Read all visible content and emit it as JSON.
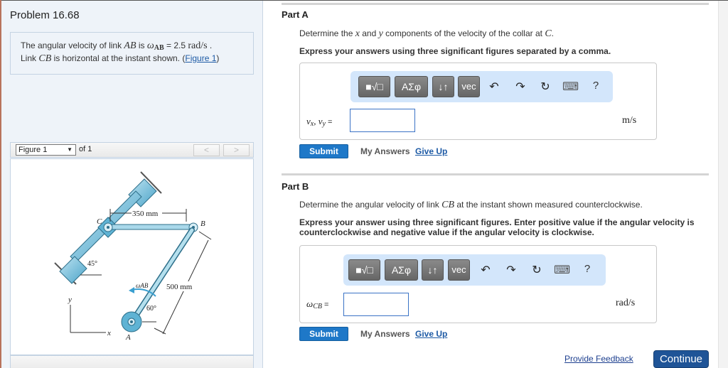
{
  "problem": {
    "title": "Problem 16.68",
    "statement": {
      "prefix": "The angular velocity of link ",
      "link_ab": "AB",
      "is": " is ",
      "omega": "ω",
      "omega_sub": "AB",
      "equals": " = 2.5 ",
      "unit": "rad/s",
      "period": " .",
      "line2_prefix": "Link ",
      "link_cb": "CB",
      "line2_suffix": " is horizontal at the instant shown. (",
      "figure_link": "Figure 1",
      "close_paren": ")"
    }
  },
  "figure_viewer": {
    "selected": "Figure 1",
    "of_label": "of 1",
    "prev": "<",
    "next": ">",
    "labels": {
      "dim_cb": "350 mm",
      "dim_ab": "500 mm",
      "c": "C",
      "b": "B",
      "a": "A",
      "angle_collar": "45°",
      "angle_ab": "60°",
      "omega_ab": "ωAB",
      "axis_x": "x",
      "axis_y": "y"
    }
  },
  "part_a": {
    "title": "Part A",
    "question_prefix": "Determine the ",
    "var_x": "x",
    "and": " and ",
    "var_y": "y",
    "question_mid": " components of the velocity of the collar at ",
    "point": "C",
    "question_end": ".",
    "instruction": "Express your answers using three significant figures separated by a comma.",
    "answer_label": "vx, vy",
    "answer_label_parts": {
      "v1": "v",
      "s1": "x",
      "sep": ", ",
      "v2": "v",
      "s2": "y",
      "eq": " ="
    },
    "answer_value": "",
    "unit": "m/s",
    "submit": "Submit",
    "my_answers": "My Answers",
    "give_up": "Give Up"
  },
  "part_b": {
    "title": "Part B",
    "question_prefix": "Determine the angular velocity of link ",
    "link": "CB",
    "question_suffix": " at the instant shown measured counterclockwise.",
    "instruction": "Express your answer using three significant figures. Enter positive value if the angular velocity is counterclockwise and negative value if the angular velocity is clockwise.",
    "answer_label_parts": {
      "w": "ω",
      "sub": "CB",
      "eq": " ="
    },
    "answer_value": "",
    "unit": "rad/s",
    "submit": "Submit",
    "my_answers": "My Answers",
    "give_up": "Give Up"
  },
  "toolbar": {
    "templates": "■√□",
    "greek": "ΑΣφ",
    "arrows": "↓↑",
    "vec": "vec",
    "undo": "↶",
    "redo": "↷",
    "reset": "↻",
    "keyboard": "⌨",
    "help": "?"
  },
  "footer": {
    "feedback": "Provide Feedback",
    "continue": "Continue"
  }
}
